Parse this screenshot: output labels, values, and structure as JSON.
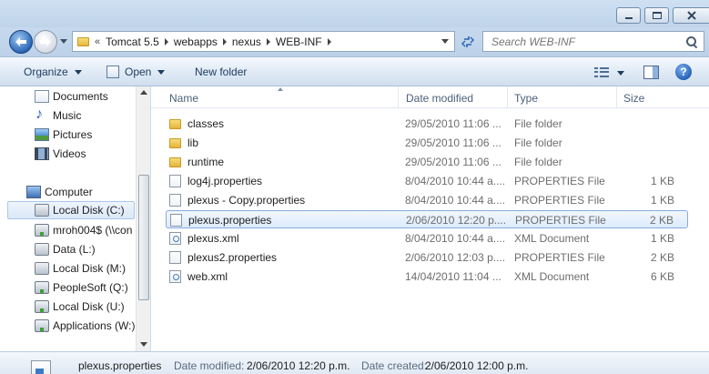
{
  "window": {
    "min_label": "",
    "max_label": "",
    "close_label": ""
  },
  "address": {
    "overflow": "«",
    "crumbs": [
      "Tomcat 5.5",
      "webapps",
      "nexus",
      "WEB-INF"
    ]
  },
  "search": {
    "placeholder": "Search WEB-INF"
  },
  "toolbar": {
    "organize": "Organize",
    "open": "Open",
    "new_folder": "New folder"
  },
  "nav": {
    "items": [
      {
        "label": "Documents",
        "icon": "documents-icon"
      },
      {
        "label": "Music",
        "icon": "music-icon"
      },
      {
        "label": "Pictures",
        "icon": "pictures-icon"
      },
      {
        "label": "Videos",
        "icon": "videos-icon"
      },
      {
        "label": "Computer",
        "icon": "computer-icon"
      },
      {
        "label": "Local Disk (C:)",
        "icon": "drive-icon",
        "selected": true
      },
      {
        "label": "mroh004$ (\\\\con",
        "icon": "network-drive-icon"
      },
      {
        "label": "Data (L:)",
        "icon": "drive-icon"
      },
      {
        "label": "Local Disk (M:)",
        "icon": "drive-icon"
      },
      {
        "label": "PeopleSoft (Q:)",
        "icon": "network-drive-icon"
      },
      {
        "label": "Local Disk (U:)",
        "icon": "network-drive-icon"
      },
      {
        "label": "Applications (W:)",
        "icon": "network-drive-icon"
      }
    ]
  },
  "columns": {
    "name": "Name",
    "date": "Date modified",
    "type": "Type",
    "size": "Size"
  },
  "files": [
    {
      "name": "classes",
      "date": "29/05/2010 11:06 ...",
      "type": "File folder",
      "size": "",
      "icon": "folder-icon"
    },
    {
      "name": "lib",
      "date": "29/05/2010 11:06 ...",
      "type": "File folder",
      "size": "",
      "icon": "folder-icon"
    },
    {
      "name": "runtime",
      "date": "29/05/2010 11:06 ...",
      "type": "File folder",
      "size": "",
      "icon": "folder-icon"
    },
    {
      "name": "log4j.properties",
      "date": "8/04/2010 10:44 a....",
      "type": "PROPERTIES File",
      "size": "1 KB",
      "icon": "file-icon"
    },
    {
      "name": "plexus - Copy.properties",
      "date": "8/04/2010 10:44 a....",
      "type": "PROPERTIES File",
      "size": "1 KB",
      "icon": "file-icon"
    },
    {
      "name": "plexus.properties",
      "date": "2/06/2010 12:20 p....",
      "type": "PROPERTIES File",
      "size": "2 KB",
      "icon": "file-icon",
      "selected": true
    },
    {
      "name": "plexus.xml",
      "date": "8/04/2010 10:44 a....",
      "type": "XML Document",
      "size": "1 KB",
      "icon": "xml-icon"
    },
    {
      "name": "plexus2.properties",
      "date": "2/06/2010 12:03 p....",
      "type": "PROPERTIES File",
      "size": "2 KB",
      "icon": "file-icon"
    },
    {
      "name": "web.xml",
      "date": "14/04/2010 11:04 ...",
      "type": "XML Document",
      "size": "6 KB",
      "icon": "xml-icon"
    }
  ],
  "details": {
    "name": "plexus.properties",
    "modified_label": "Date modified:",
    "modified_value": "2/06/2010 12:20 p.m.",
    "created_label": "Date created:",
    "created_value": "2/06/2010 12:00 p.m."
  }
}
